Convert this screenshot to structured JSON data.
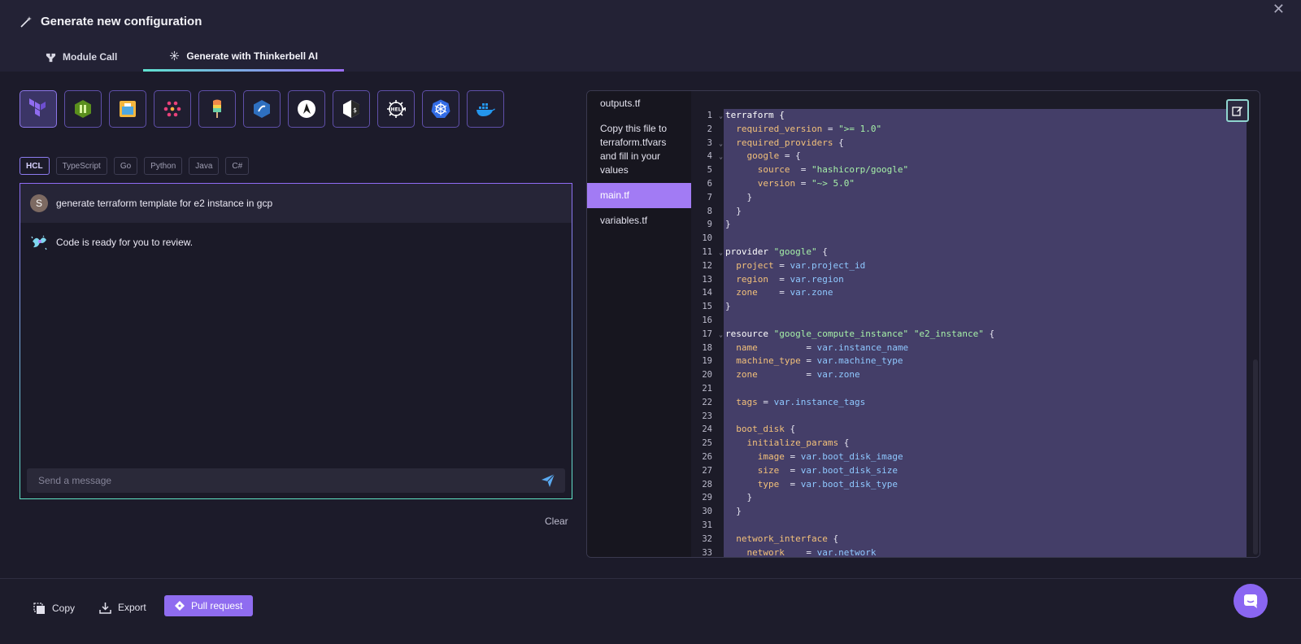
{
  "header": {
    "title": "Generate new configuration",
    "tabs": [
      {
        "label": "Module Call",
        "icon": "module-icon",
        "active": false
      },
      {
        "label": "Generate with Thinkerbell AI",
        "icon": "thinkerbell-icon",
        "active": true
      }
    ]
  },
  "tool_icons": [
    "terraform-icon",
    "opentofu-icon",
    "pulumi-icon",
    "cloudformation-icon",
    "popsicle-icon",
    "crossplane-icon",
    "ansible-icon",
    "shell-script-icon",
    "helm-icon",
    "kubernetes-icon",
    "docker-icon"
  ],
  "languages": [
    {
      "label": "HCL",
      "active": true
    },
    {
      "label": "TypeScript",
      "active": false
    },
    {
      "label": "Go",
      "active": false
    },
    {
      "label": "Python",
      "active": false
    },
    {
      "label": "Java",
      "active": false
    },
    {
      "label": "C#",
      "active": false
    }
  ],
  "chat": {
    "user_initial": "S",
    "user_message": "generate terraform template for e2 instance in gcp",
    "ai_message": "Code is ready for you to review.",
    "input_placeholder": "Send a message",
    "clear_label": "Clear"
  },
  "files": [
    {
      "name": "outputs.tf",
      "active": false
    },
    {
      "name": "Copy this file to terraform.tfvars and fill in your values",
      "active": false
    },
    {
      "name": "main.tf",
      "active": true
    },
    {
      "name": "variables.tf",
      "active": false
    }
  ],
  "code": {
    "folds": [
      1,
      3,
      4,
      11,
      17
    ],
    "lines": [
      [
        [
          "k",
          "terraform {"
        ]
      ],
      [
        [
          "a",
          "  required_version"
        ],
        [
          "p",
          " = "
        ],
        [
          "s",
          "\">= 1.0\""
        ]
      ],
      [
        [
          "a",
          "  required_providers"
        ],
        [
          "p",
          " {"
        ]
      ],
      [
        [
          "a",
          "    google"
        ],
        [
          "p",
          " = {"
        ]
      ],
      [
        [
          "a",
          "      source "
        ],
        [
          "p",
          " = "
        ],
        [
          "s",
          "\"hashicorp/google\""
        ]
      ],
      [
        [
          "a",
          "      version"
        ],
        [
          "p",
          " = "
        ],
        [
          "s",
          "\"~> 5.0\""
        ]
      ],
      [
        [
          "p",
          "    }"
        ]
      ],
      [
        [
          "p",
          "  }"
        ]
      ],
      [
        [
          "p",
          "}"
        ]
      ],
      [
        [
          "p",
          ""
        ]
      ],
      [
        [
          "k",
          "provider "
        ],
        [
          "s",
          "\"google\""
        ],
        [
          "p",
          " {"
        ]
      ],
      [
        [
          "a",
          "  project"
        ],
        [
          "p",
          " = "
        ],
        [
          "v",
          "var.project_id"
        ]
      ],
      [
        [
          "a",
          "  region "
        ],
        [
          "p",
          " = "
        ],
        [
          "v",
          "var.region"
        ]
      ],
      [
        [
          "a",
          "  zone   "
        ],
        [
          "p",
          " = "
        ],
        [
          "v",
          "var.zone"
        ]
      ],
      [
        [
          "p",
          "}"
        ]
      ],
      [
        [
          "p",
          ""
        ]
      ],
      [
        [
          "k",
          "resource "
        ],
        [
          "s",
          "\"google_compute_instance\""
        ],
        [
          "p",
          " "
        ],
        [
          "s",
          "\"e2_instance\""
        ],
        [
          "p",
          " {"
        ]
      ],
      [
        [
          "a",
          "  name        "
        ],
        [
          "p",
          " = "
        ],
        [
          "v",
          "var.instance_name"
        ]
      ],
      [
        [
          "a",
          "  machine_type"
        ],
        [
          "p",
          " = "
        ],
        [
          "v",
          "var.machine_type"
        ]
      ],
      [
        [
          "a",
          "  zone        "
        ],
        [
          "p",
          " = "
        ],
        [
          "v",
          "var.zone"
        ]
      ],
      [
        [
          "p",
          ""
        ]
      ],
      [
        [
          "a",
          "  tags"
        ],
        [
          "p",
          " = "
        ],
        [
          "v",
          "var.instance_tags"
        ]
      ],
      [
        [
          "p",
          ""
        ]
      ],
      [
        [
          "a",
          "  boot_disk"
        ],
        [
          "p",
          " {"
        ]
      ],
      [
        [
          "a",
          "    initialize_params"
        ],
        [
          "p",
          " {"
        ]
      ],
      [
        [
          "a",
          "      image"
        ],
        [
          "p",
          " = "
        ],
        [
          "v",
          "var.boot_disk_image"
        ]
      ],
      [
        [
          "a",
          "      size "
        ],
        [
          "p",
          " = "
        ],
        [
          "v",
          "var.boot_disk_size"
        ]
      ],
      [
        [
          "a",
          "      type "
        ],
        [
          "p",
          " = "
        ],
        [
          "v",
          "var.boot_disk_type"
        ]
      ],
      [
        [
          "p",
          "    }"
        ]
      ],
      [
        [
          "p",
          "  }"
        ]
      ],
      [
        [
          "p",
          ""
        ]
      ],
      [
        [
          "a",
          "  network_interface"
        ],
        [
          "p",
          " {"
        ]
      ],
      [
        [
          "a",
          "    network   "
        ],
        [
          "p",
          " = "
        ],
        [
          "v",
          "var.network"
        ]
      ]
    ]
  },
  "footer": {
    "copy_label": "Copy",
    "export_label": "Export",
    "pull_request_label": "Pull request"
  }
}
